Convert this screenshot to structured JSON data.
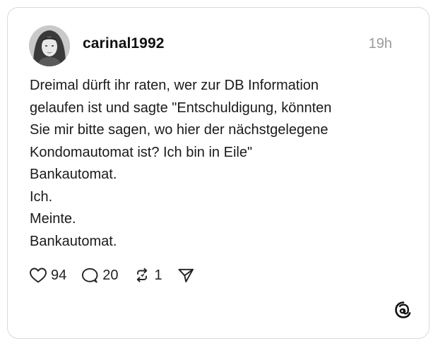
{
  "post": {
    "username": "carinal1992",
    "timestamp": "19h",
    "lines": [
      "Dreimal dürft ihr raten, wer zur DB Information",
      "gelaufen ist und sagte \"Entschuldigung, könnten",
      "Sie mir bitte sagen, wo hier der nächstgelegene",
      "Kondomautomat ist? Ich bin in Eile\"",
      "Bankautomat.",
      "Ich.",
      "Meinte.",
      "Bankautomat."
    ],
    "actions": {
      "likes": "94",
      "replies": "20",
      "reposts": "1"
    }
  },
  "icons": {
    "like": "heart-icon",
    "reply": "speech-bubble-icon",
    "repost": "repost-icon",
    "share": "send-icon",
    "brand": "threads-logo-icon"
  },
  "colors": {
    "text": "#1a1a1a",
    "muted": "#9a9a9a",
    "border": "#d9d9d9"
  }
}
